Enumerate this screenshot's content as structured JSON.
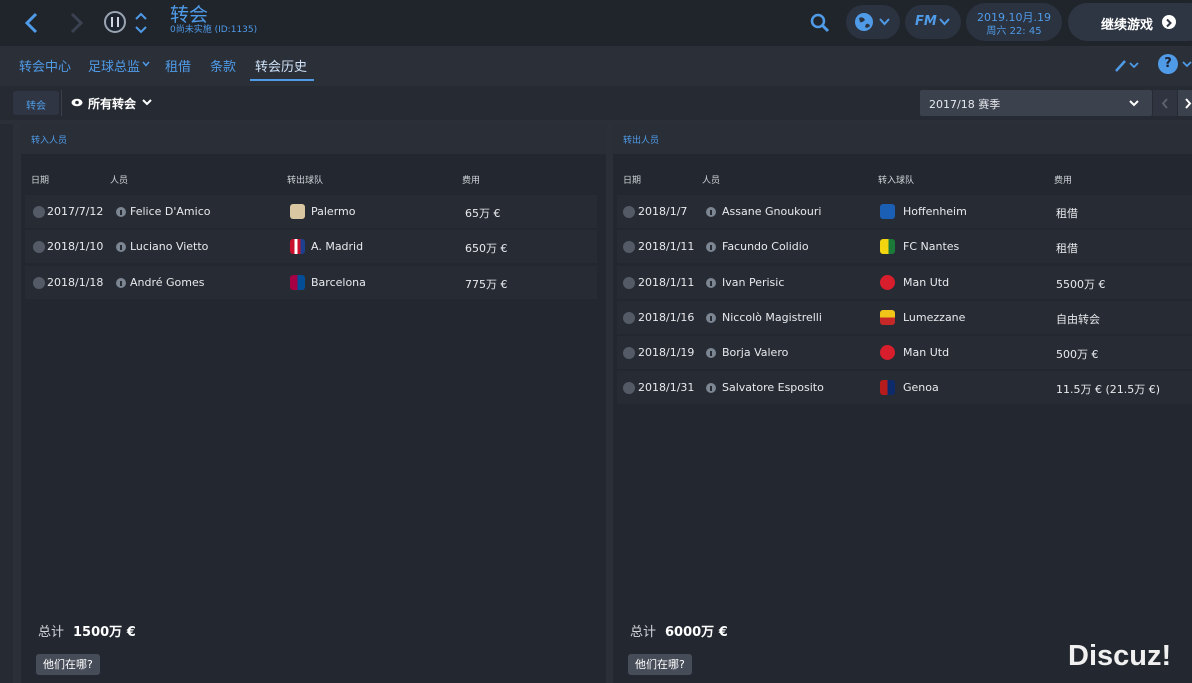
{
  "header": {
    "title": "转会",
    "subtitle": "0尚未实施 (ID:1135)",
    "date_line1": "2019.10月.19",
    "date_line2": "周六 22: 45",
    "fm_label": "FM",
    "continue_label": "继续游戏"
  },
  "subnav": {
    "items": [
      "转会中心",
      "足球总监",
      "租借",
      "条款",
      "转会历史"
    ],
    "active": "转会历史"
  },
  "filter": {
    "tab_label": "转会",
    "view_label": "所有转会",
    "season_label": "2017/18 赛季"
  },
  "incoming": {
    "title": "转入人员",
    "columns": [
      "日期",
      "人员",
      "转出球队",
      "费用"
    ],
    "rows": [
      {
        "date": "2017/7/12",
        "person": "Felice D'Amico",
        "club": "Palermo",
        "fee": "65万 €"
      },
      {
        "date": "2018/1/10",
        "person": "Luciano Vietto",
        "club": "A. Madrid",
        "fee": "650万 €"
      },
      {
        "date": "2018/1/18",
        "person": "André Gomes",
        "club": "Barcelona",
        "fee": "775万 €"
      }
    ],
    "total_label": "总计",
    "total_value": "1500万 €",
    "where_label": "他们在哪?"
  },
  "outgoing": {
    "title": "转出人员",
    "columns": [
      "日期",
      "人员",
      "转入球队",
      "费用"
    ],
    "rows": [
      {
        "date": "2018/1/7",
        "person": "Assane Gnoukouri",
        "club": "Hoffenheim",
        "fee": "租借"
      },
      {
        "date": "2018/1/11",
        "person": "Facundo Colidio",
        "club": "FC Nantes",
        "fee": "租借"
      },
      {
        "date": "2018/1/11",
        "person": "Ivan Perisic",
        "club": "Man Utd",
        "fee": "5500万 €"
      },
      {
        "date": "2018/1/16",
        "person": "Niccolò Magistrelli",
        "club": "Lumezzane",
        "fee": "自由转会"
      },
      {
        "date": "2018/1/19",
        "person": "Borja Valero",
        "club": "Man Utd",
        "fee": "500万 €"
      },
      {
        "date": "2018/1/31",
        "person": "Salvatore Esposito",
        "club": "Genoa",
        "fee": "11.5万 € (21.5万 €)"
      }
    ],
    "total_label": "总计",
    "total_value": "6000万 €",
    "where_label": "他们在哪?"
  },
  "watermark": "Discuz!",
  "colors": {
    "accent": "#4f9be8",
    "background": "#2b2f38",
    "panel": "#23272f"
  }
}
